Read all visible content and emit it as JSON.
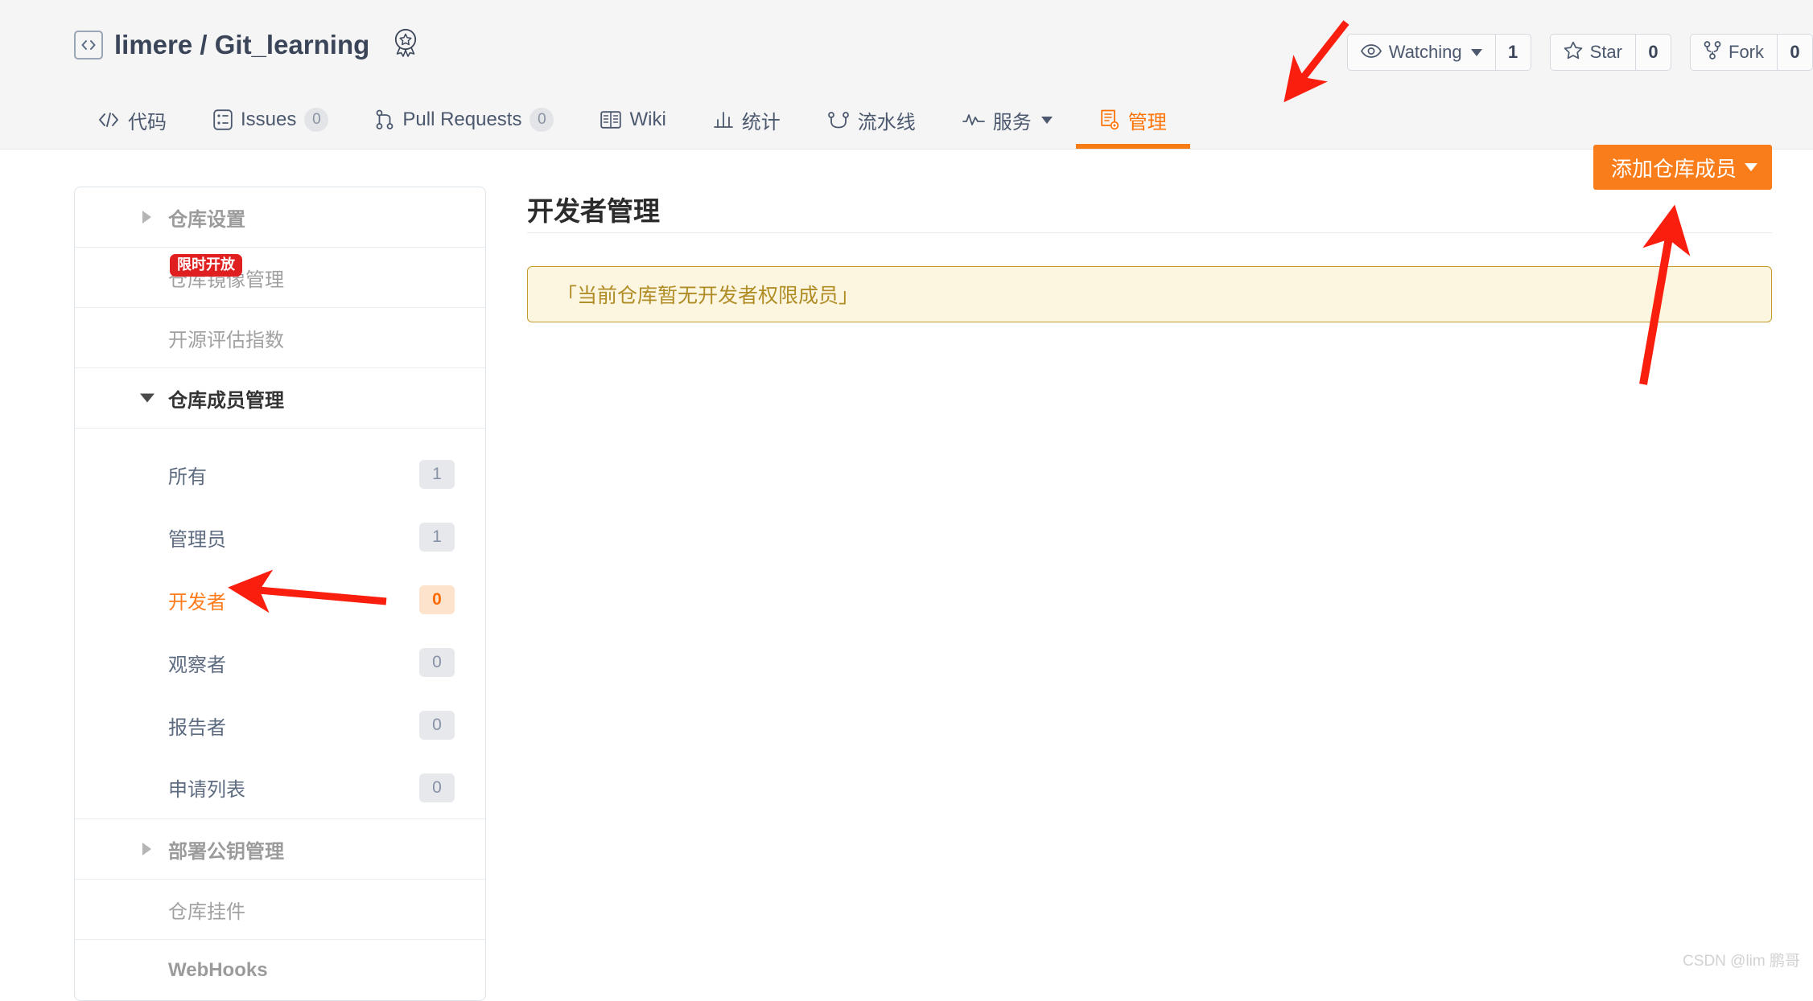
{
  "header": {
    "repo_icon": "code-brackets-icon",
    "owner": "limere",
    "separator": "/",
    "repo_name": "Git_learning",
    "full_title": "limere / Git_learning",
    "award_icon": "award-badge-icon",
    "actions": [
      {
        "icon": "eye-icon",
        "label": "Watching",
        "has_caret": true,
        "count": "1"
      },
      {
        "icon": "star-icon",
        "label": "Star",
        "has_caret": false,
        "count": "0"
      },
      {
        "icon": "fork-icon",
        "label": "Fork",
        "has_caret": false,
        "count": "0"
      }
    ]
  },
  "nav": {
    "tabs": [
      {
        "icon": "code-icon",
        "label": "代码",
        "count": null,
        "active": false,
        "caret": false
      },
      {
        "icon": "issues-icon",
        "label": "Issues",
        "count": "0",
        "active": false,
        "caret": false
      },
      {
        "icon": "pull-request-icon",
        "label": "Pull Requests",
        "count": "0",
        "active": false,
        "caret": false
      },
      {
        "icon": "wiki-book-icon",
        "label": "Wiki",
        "count": null,
        "active": false,
        "caret": false
      },
      {
        "icon": "statistics-icon",
        "label": "统计",
        "count": null,
        "active": false,
        "caret": false
      },
      {
        "icon": "pipeline-icon",
        "label": "流水线",
        "count": null,
        "active": false,
        "caret": false
      },
      {
        "icon": "service-pulse-icon",
        "label": "服务",
        "count": null,
        "active": false,
        "caret": true
      },
      {
        "icon": "manage-doc-gear-icon",
        "label": "管理",
        "count": null,
        "active": true,
        "caret": false
      }
    ]
  },
  "sidebar": {
    "groups": [
      {
        "type": "group",
        "label": "仓库设置",
        "expanded": false,
        "badge": null
      },
      {
        "type": "item",
        "label": "仓库镜像管理",
        "badge": "限时开放"
      },
      {
        "type": "item",
        "label": "开源评估指数",
        "badge": null
      },
      {
        "type": "group",
        "label": "仓库成员管理",
        "expanded": true,
        "badge": null
      }
    ],
    "members": [
      {
        "label": "所有",
        "count": "1",
        "selected": false
      },
      {
        "label": "管理员",
        "count": "1",
        "selected": false
      },
      {
        "label": "开发者",
        "count": "0",
        "selected": true
      },
      {
        "label": "观察者",
        "count": "0",
        "selected": false
      },
      {
        "label": "报告者",
        "count": "0",
        "selected": false
      },
      {
        "label": "申请列表",
        "count": "0",
        "selected": false
      }
    ],
    "tail": [
      {
        "type": "group",
        "label": "部署公钥管理",
        "expanded": false
      },
      {
        "type": "item",
        "label": "仓库挂件"
      },
      {
        "type": "item",
        "label": "WebHooks"
      }
    ]
  },
  "main": {
    "title": "开发者管理",
    "add_button_label": "添加仓库成员",
    "empty_notice": "「当前仓库暂无开发者权限成员」"
  },
  "watermark": "CSDN @lim 鹏哥",
  "colors": {
    "accent_orange": "#fa7d1b",
    "active_tab_orange": "#ff7200",
    "notice_bg": "#fcf6e0",
    "notice_border": "#c49a2c",
    "notice_text": "#b08c25",
    "hot_badge_red": "#e02020",
    "annotation_red": "#fa1e0e",
    "header_bg": "#f5f5f5",
    "title_navy": "#3b4559"
  }
}
